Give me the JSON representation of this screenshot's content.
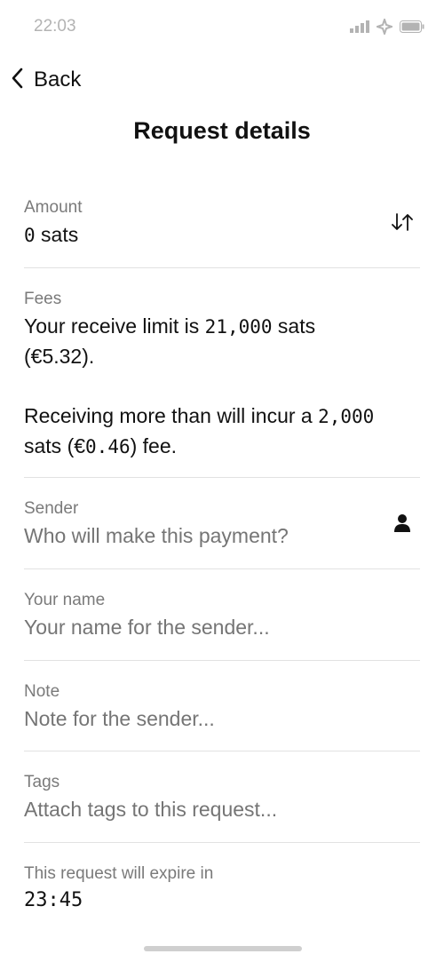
{
  "status_bar": {
    "time": "22:03",
    "icons": [
      "signal-icon",
      "wifi-icon",
      "battery-icon"
    ]
  },
  "nav": {
    "back_label": "Back",
    "back_icon": "chevron-left-icon"
  },
  "page": {
    "title": "Request details"
  },
  "amount": {
    "label": "Amount",
    "number": "0",
    "unit": "sats",
    "toggle_icon": "swap-arrows-icon"
  },
  "fees": {
    "label": "Fees",
    "line1_prefix": "Your receive limit is ",
    "line1_amount": "21,000",
    "line1_suffix": " sats",
    "line1_fiat": "(€5.32).",
    "line2_prefix": "Receiving more than will incur a ",
    "line2_amount": "2,000",
    "line2_mid": "sats (€",
    "line2_fiat": "0.46",
    "line2_suffix": ") fee."
  },
  "sender": {
    "label": "Sender",
    "placeholder": "Who will make this payment?",
    "icon": "contact-person-icon"
  },
  "your_name": {
    "label": "Your name",
    "placeholder": "Your name for the sender..."
  },
  "note": {
    "label": "Note",
    "placeholder": "Note for the sender..."
  },
  "tags": {
    "label": "Tags",
    "placeholder": "Attach tags to this request..."
  },
  "expiry": {
    "label": "This request will expire in",
    "value": "23:45"
  },
  "colors": {
    "text": "#111111",
    "label": "#7a7a7a",
    "placeholder": "#c4c4c4",
    "divider": "#e2e2e2",
    "status": "#b3b3b3"
  }
}
